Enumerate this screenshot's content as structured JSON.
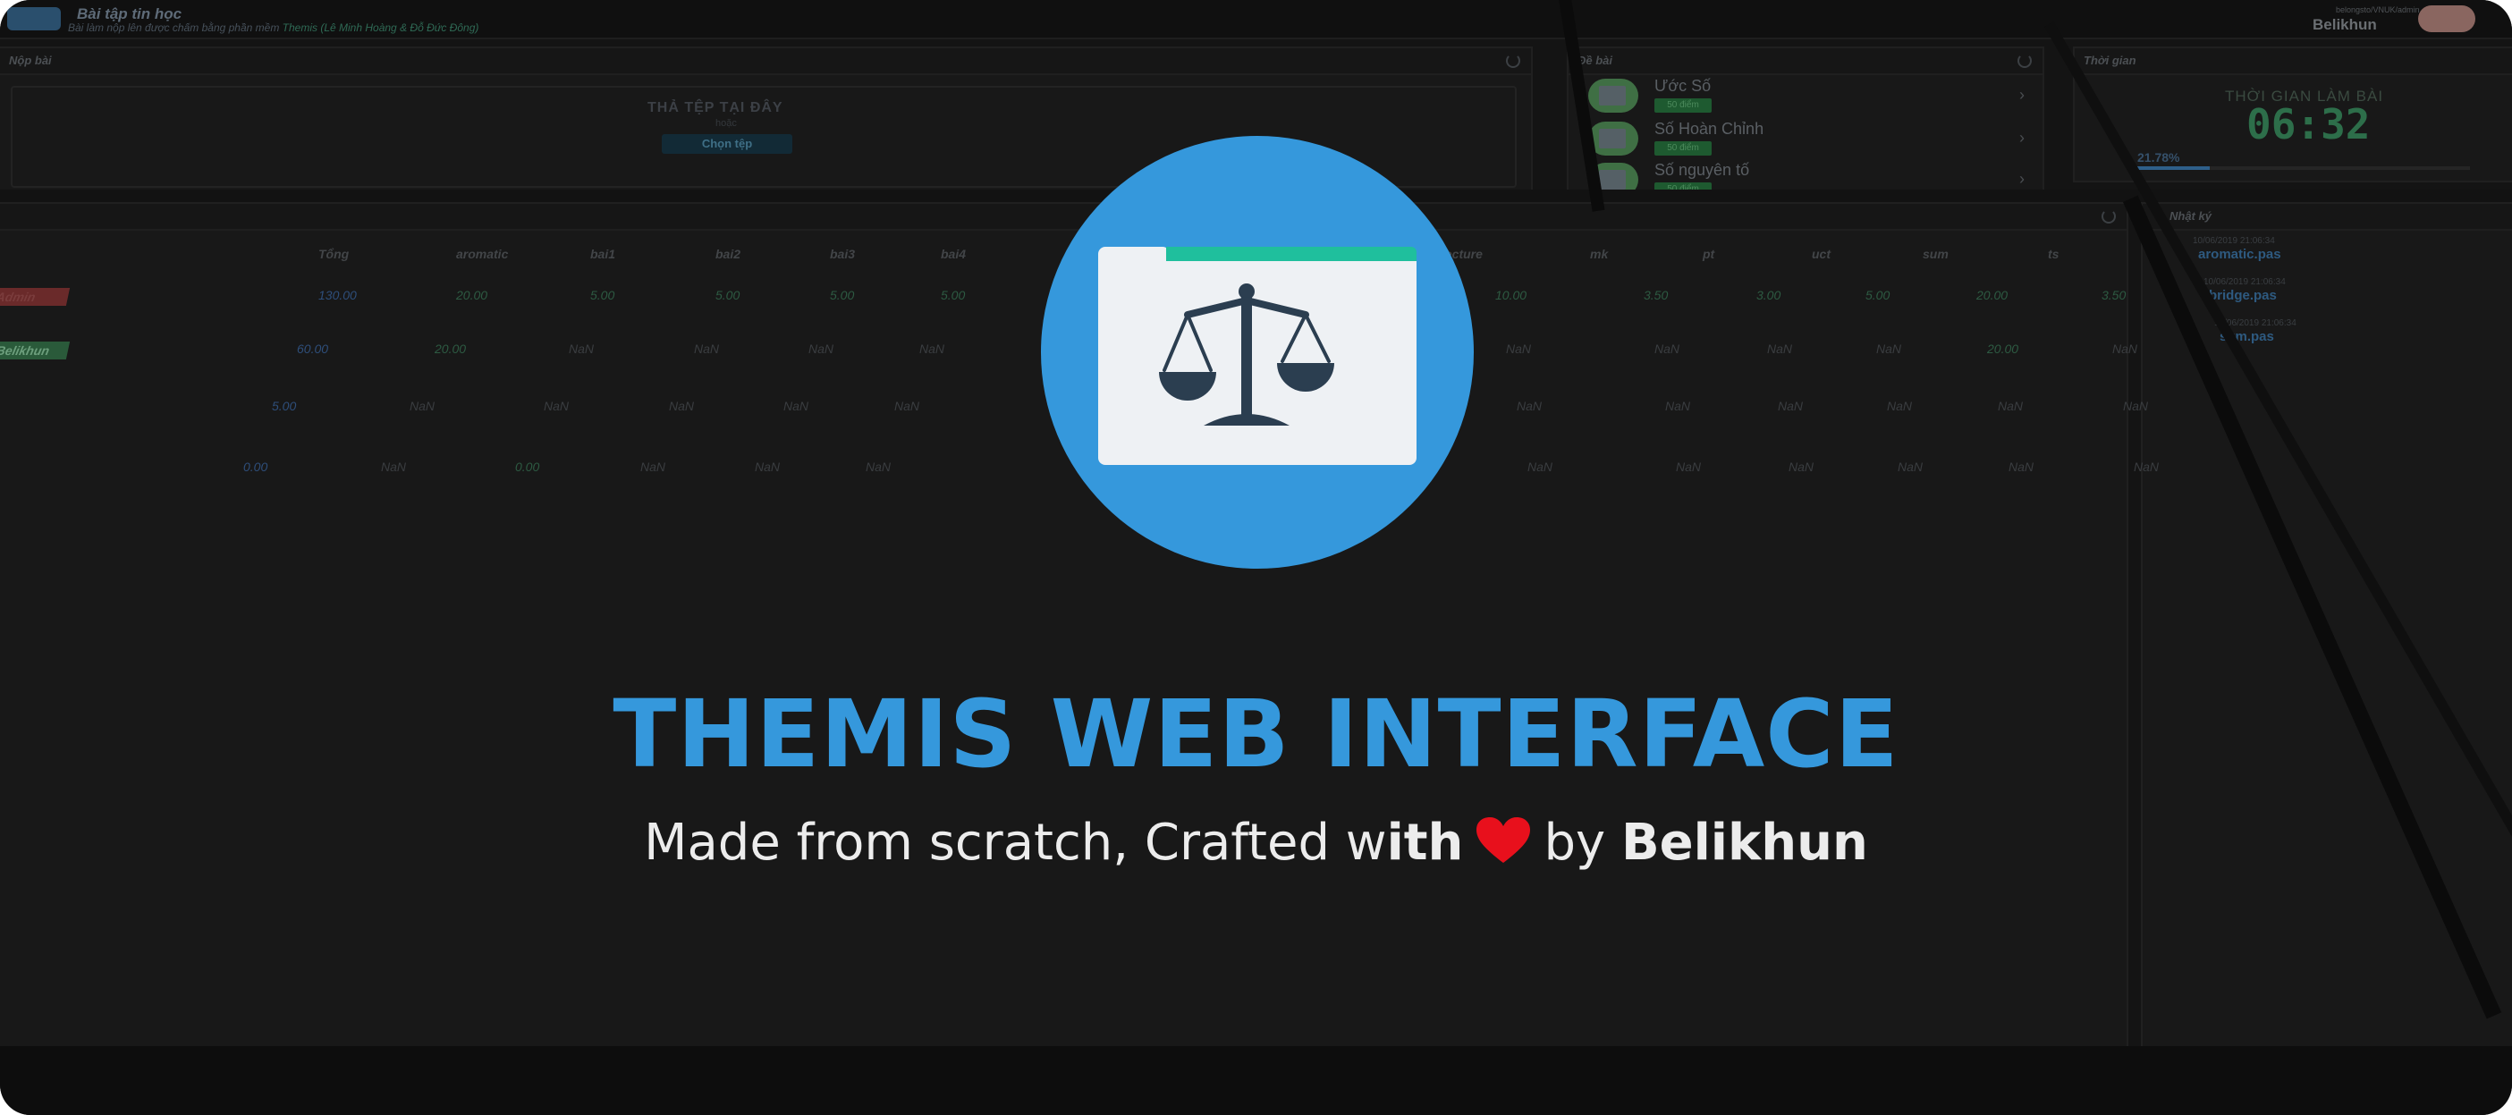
{
  "header": {
    "title": "Bài tập tin học",
    "subtitle": "Bài làm nộp lên được chấm bằng phần mềm",
    "subtitle_highlight": "Themis (Lê Minh Hoàng & Đỗ Đức Đông)",
    "user_label": "belongsto/VNUK/admin",
    "username": "Belikhun"
  },
  "submit_panel": {
    "title": "Nộp bài",
    "drop_title": "THẢ TỆP TẠI ĐÂY",
    "drop_or": "hoặc",
    "choose_button": "Chọn tệp"
  },
  "problems_panel": {
    "title": "Đề bài",
    "items": [
      {
        "name": "Ước Số",
        "badge": "50 điểm"
      },
      {
        "name": "Số Hoàn Chỉnh",
        "badge": "50 điểm"
      },
      {
        "name": "Số nguyên tố",
        "badge": "50 điểm"
      }
    ]
  },
  "time_panel": {
    "title": "Thời gian",
    "label": "THỜI GIAN LÀM BÀI",
    "value": "06:32",
    "progress_text": "21.78%",
    "progress": 0.2178
  },
  "rank_table": {
    "columns_left": [
      "Tổng",
      "aromatic",
      "bai1",
      "bai2",
      "bai3",
      "bai4"
    ],
    "columns_right": [
      "lecture",
      "mk",
      "pt",
      "uct",
      "sum",
      "ts"
    ],
    "rows": [
      {
        "user": "Admin",
        "tag": "red",
        "left": [
          "130.00",
          "20.00",
          "5.00",
          "5.00",
          "5.00",
          "5.00"
        ],
        "right": [
          "10.00",
          "3.50",
          "3.00",
          "5.00",
          "20.00",
          "3.50"
        ]
      },
      {
        "user": "Belikhun",
        "tag": "green",
        "left": [
          "60.00",
          "20.00",
          "NaN",
          "NaN",
          "NaN",
          "NaN"
        ],
        "right": [
          "NaN",
          "NaN",
          "NaN",
          "NaN",
          "20.00",
          "NaN"
        ]
      },
      {
        "user": "",
        "tag": "",
        "left": [
          "5.00",
          "NaN",
          "NaN",
          "NaN",
          "NaN",
          "NaN"
        ],
        "right": [
          "NaN",
          "NaN",
          "NaN",
          "NaN",
          "NaN",
          "NaN"
        ]
      },
      {
        "user": "",
        "tag": "",
        "left": [
          "0.00",
          "NaN",
          "0.00",
          "NaN",
          "NaN",
          "NaN"
        ],
        "right": [
          "NaN",
          "NaN",
          "NaN",
          "NaN",
          "NaN",
          "NaN"
        ]
      }
    ]
  },
  "log_panel": {
    "title": "Nhật ký",
    "entries": [
      {
        "time": "10/06/2019 21:06:34",
        "file": "aromatic.pas"
      },
      {
        "time": "10/06/2019 21:06:34",
        "file": "bridge.pas"
      },
      {
        "time": "10/06/2019 21:06:34",
        "file": "sum.pas"
      }
    ]
  },
  "hero": {
    "title": "THEMIS WEB INTERFACE",
    "tagline_prefix": "Made from scratch, Crafted w",
    "tagline_bold": "ith",
    "tagline_by": "by",
    "author": "Belikhun",
    "logo_icon": "scale-folder-icon",
    "heart_icon": "heart-icon"
  },
  "colors": {
    "brand_blue": "#3598dc",
    "accent_teal": "#1fbf9d",
    "heart_red": "#e8101c",
    "background": "#141414"
  }
}
